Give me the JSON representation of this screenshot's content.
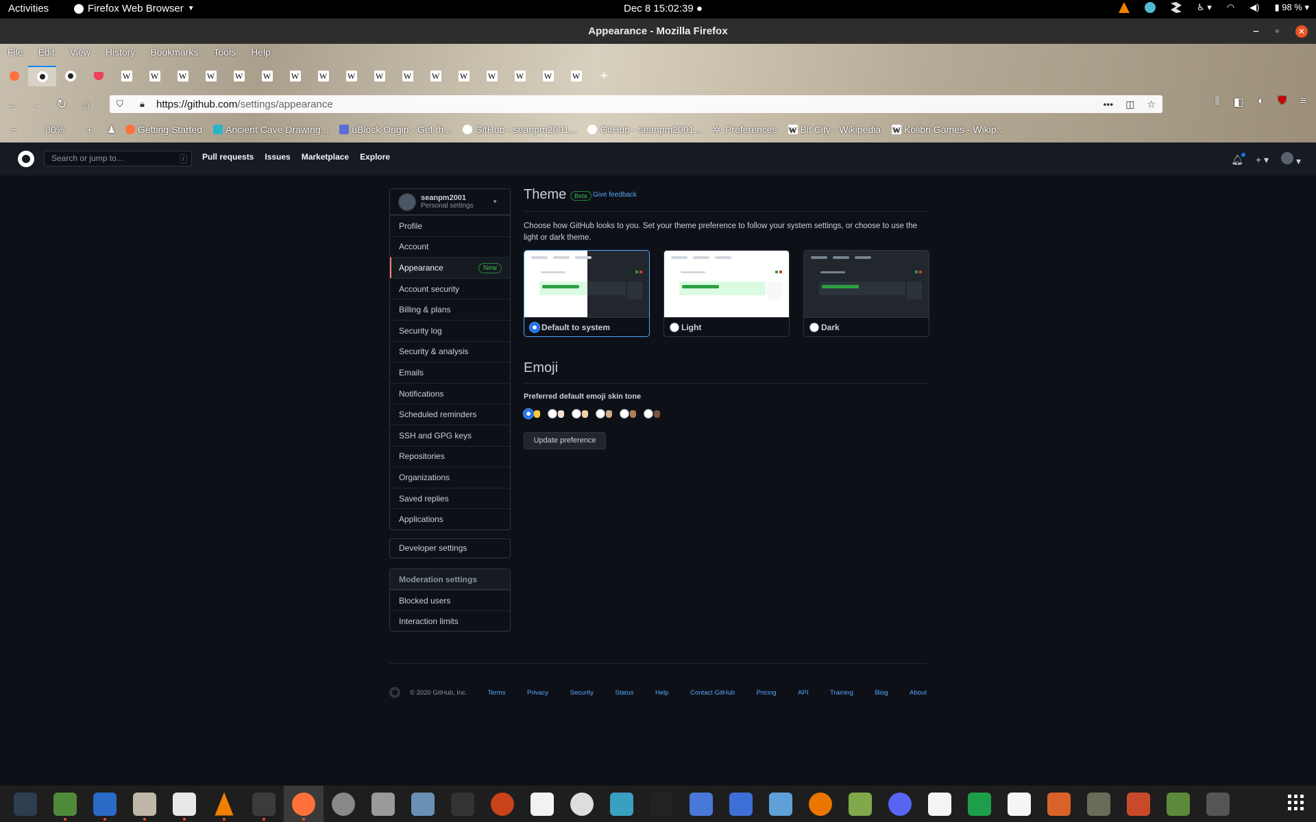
{
  "system": {
    "activities": "Activities",
    "app_name": "Firefox Web Browser",
    "clock": "Dec 8  15:02:39",
    "battery": "98 %"
  },
  "window": {
    "title": "Appearance - Mozilla Firefox"
  },
  "menu": [
    "File",
    "Edit",
    "View",
    "History",
    "Bookmarks",
    "Tools",
    "Help"
  ],
  "url": {
    "domain": "https://github.com",
    "path": "/settings/appearance"
  },
  "zoom": "80%",
  "bookmarks": [
    "Getting Started",
    "Ancient Cave Drawing...",
    "uBlock Origin - Get th...",
    "GitHub - seanpm2001...",
    "GitHub - seanpm2001...",
    "Preferences",
    "Bit City - Wikipedia",
    "Kolibri Games - Wikip..."
  ],
  "github": {
    "search_placeholder": "Search or jump to...",
    "search_key": "/",
    "nav": [
      "Pull requests",
      "Issues",
      "Marketplace",
      "Explore"
    ]
  },
  "sidebar": {
    "username": "seanpm2001",
    "subtitle": "Personal settings",
    "items": [
      "Profile",
      "Account",
      "Appearance",
      "Account security",
      "Billing & plans",
      "Security log",
      "Security & analysis",
      "Emails",
      "Notifications",
      "Scheduled reminders",
      "SSH and GPG keys",
      "Repositories",
      "Organizations",
      "Saved replies",
      "Applications"
    ],
    "new_badge": "New",
    "developer": "Developer settings",
    "moderation_title": "Moderation settings",
    "moderation_items": [
      "Blocked users",
      "Interaction limits"
    ]
  },
  "theme": {
    "title": "Theme",
    "beta": "Beta",
    "feedback": "Give feedback",
    "description": "Choose how GitHub looks to you. Set your theme preference to follow your system settings, or choose to use the light or dark theme.",
    "options": [
      "Default to system",
      "Light",
      "Dark"
    ],
    "selected": "Default to system"
  },
  "emoji": {
    "title": "Emoji",
    "label": "Preferred default emoji skin tone",
    "tone_colors": [
      "#ffc83d",
      "#f7dece",
      "#f3d2a2",
      "#d5ab88",
      "#af7e57",
      "#7c533e"
    ],
    "selected_index": 0,
    "button": "Update preference"
  },
  "footer": {
    "copyright": "© 2020 GitHub, Inc.",
    "links": [
      "Terms",
      "Privacy",
      "Security",
      "Status",
      "Help",
      "Contact GitHub",
      "Pricing",
      "API",
      "Training",
      "Blog",
      "About"
    ]
  }
}
